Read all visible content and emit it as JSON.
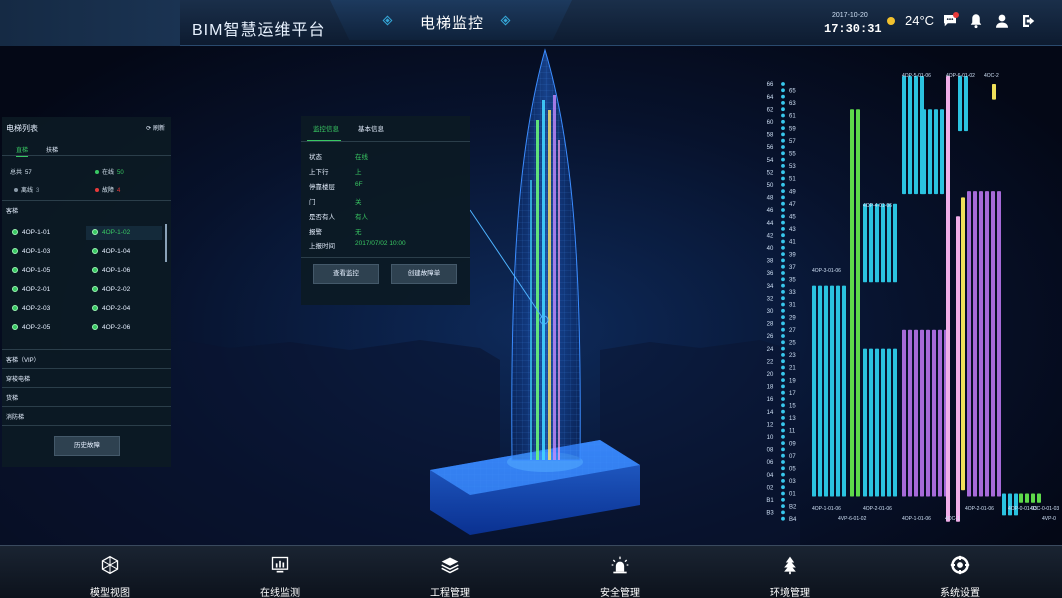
{
  "header": {
    "app_title": "BIM智慧运维平台",
    "page_title": "电梯监控",
    "date": "2017-10-20",
    "time": "17:30:31",
    "temperature": "24°C",
    "weather_icon": "sun-icon",
    "icons": [
      "chat-icon",
      "bell-icon",
      "user-icon",
      "logout-icon"
    ]
  },
  "elevator_list": {
    "title": "电梯列表",
    "refresh_label": "刷新",
    "tabs": [
      "直梯",
      "扶梯"
    ],
    "active_tab": "直梯",
    "stats": {
      "total_label": "总共",
      "total": "57",
      "online_label": "在线",
      "online": "50",
      "offline_label": "离线",
      "offline": "3",
      "fault_label": "故障",
      "fault": "4"
    },
    "group_passenger": "客梯",
    "items": [
      "4OP-1-01",
      "4OP-1-02",
      "4OP-1-03",
      "4OP-1-04",
      "4OP-1-05",
      "4OP-1-06",
      "4OP-2-01",
      "4OP-2-02",
      "4OP-2-03",
      "4OP-2-04",
      "4OP-2-05",
      "4OP-2-06"
    ],
    "selected_item": "4OP-1-02",
    "group_vip": "客梯（VIP）",
    "group_shuttle": "穿梭电梯",
    "group_freight": "货梯",
    "group_fire": "消防梯",
    "history_button": "历史故障"
  },
  "info_panel": {
    "tabs": [
      "监控信息",
      "基本信息"
    ],
    "active_tab": "监控信息",
    "fields": [
      {
        "label": "状态",
        "value": "在线"
      },
      {
        "label": "上下行",
        "value": "上"
      },
      {
        "label": "停靠楼层",
        "value": "6F"
      },
      {
        "label": "门",
        "value": "关"
      },
      {
        "label": "是否有人",
        "value": "有人"
      },
      {
        "label": "报警",
        "value": "无"
      },
      {
        "label": "上报时间",
        "value": "2017/07/02 10:00"
      }
    ],
    "view_button": "查看监控",
    "create_button": "创建故障单"
  },
  "floor_chart": {
    "floors": [
      "66",
      "65",
      "64",
      "63",
      "62",
      "61",
      "60",
      "59",
      "58",
      "57",
      "56",
      "55",
      "54",
      "53",
      "52",
      "51",
      "50",
      "49",
      "48",
      "47",
      "46",
      "45",
      "44",
      "43",
      "42",
      "41",
      "40",
      "39",
      "38",
      "37",
      "36",
      "35",
      "34",
      "33",
      "32",
      "31",
      "30",
      "29",
      "28",
      "27",
      "26",
      "25",
      "24",
      "23",
      "22",
      "21",
      "20",
      "19",
      "18",
      "17",
      "16",
      "15",
      "14",
      "13",
      "12",
      "11",
      "10",
      "09",
      "08",
      "07",
      "06",
      "05",
      "04",
      "03",
      "02",
      "01",
      "B1",
      "B2",
      "B3",
      "B4"
    ],
    "group_labels": [
      "4OP-5-01-06",
      "4OP-6-01-02",
      "4OC-2",
      "4OP-4-01-06",
      "4OP-3-01-06",
      "4OP-1-01-06",
      "4VP-6-01-02",
      "4OP-2-01-06",
      "4OP-1-01-06",
      "4OC-1",
      "4OC-1-3",
      "4OP-2-01-06",
      "4OP-0-01-03",
      "4OC-0-01-03",
      "4VP-0"
    ],
    "colors": {
      "cyan": "#2bc3e0",
      "green": "#5ed94a",
      "purple": "#a66ad8",
      "pink": "#f0aee8",
      "yellow": "#f0e05a",
      "dot": "#38c7ec"
    }
  },
  "bottom_nav": [
    {
      "label": "模型视图",
      "icon": "network-icon"
    },
    {
      "label": "在线监测",
      "icon": "monitor-chart-icon"
    },
    {
      "label": "工程管理",
      "icon": "layers-icon"
    },
    {
      "label": "安全管理",
      "icon": "alarm-light-icon"
    },
    {
      "label": "环境管理",
      "icon": "tree-icon"
    },
    {
      "label": "系统设置",
      "icon": "settings-icon"
    }
  ]
}
